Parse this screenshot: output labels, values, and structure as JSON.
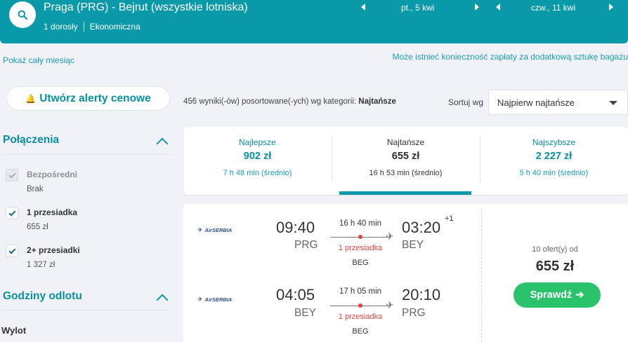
{
  "header": {
    "route": "Praga (PRG) - Bejrut (wszystkie lotniska)",
    "passengers": "1 dorosły",
    "cabin": "Ekonomiczna",
    "depart_date": "pt., 5 kwi",
    "return_date": "czw., 11 kwi"
  },
  "links": {
    "month": "Pokaż cały miesiąc",
    "baggage": "Może istnieć konieczność zapłaty za dodatkową sztukę bagażu"
  },
  "sidebar": {
    "alert_button": "Utwórz alerty cenowe",
    "connections_title": "Połączenia",
    "options": [
      {
        "label": "Bezpośredni",
        "price": "Brak",
        "checked": true,
        "disabled": true
      },
      {
        "label": "1 przesiadka",
        "price": "655 zł",
        "checked": true,
        "disabled": false
      },
      {
        "label": "2+ przesiadki",
        "price": "1 327 zł",
        "checked": true,
        "disabled": false
      }
    ],
    "departure_title": "Godziny odlotu",
    "departure_sub": "Wylot"
  },
  "results": {
    "count_text": "456 wyniki(-ów) posortowane(-ych) wg kategorii: ",
    "count_category": "Najtańsze",
    "sort_label": "Sortuj wg",
    "sort_value": "Najpierw najtańsze"
  },
  "tabs": [
    {
      "label": "Najlepsze",
      "price": "902 zł",
      "time": "7 h 48 min (średnio)"
    },
    {
      "label": "Najtańsze",
      "price": "655 zł",
      "time": "16 h 53 min (średnio)"
    },
    {
      "label": "Najszybsze",
      "price": "2 227 zł",
      "time": "5 h 40 min (średnio)"
    }
  ],
  "card": {
    "airline": "AirSERBIA",
    "outbound": {
      "dep_time": "09:40",
      "dep_code": "PRG",
      "arr_time": "03:20",
      "arr_code": "BEY",
      "day_offset": "+1",
      "duration": "16 h 40 min",
      "stops": "1 przesiadka",
      "via": "BEG"
    },
    "inbound": {
      "dep_time": "04:05",
      "dep_code": "BEY",
      "arr_time": "20:10",
      "arr_code": "PRG",
      "duration": "17 h 05 min",
      "stops": "1 przesiadka",
      "via": "BEG"
    },
    "offers": "10 ofert(y) od",
    "price": "655 zł",
    "button": "Sprawdź"
  },
  "colors": {
    "brand": "#0a99a8",
    "accent_green": "#2ac26a",
    "stop_red": "#e8413e"
  }
}
